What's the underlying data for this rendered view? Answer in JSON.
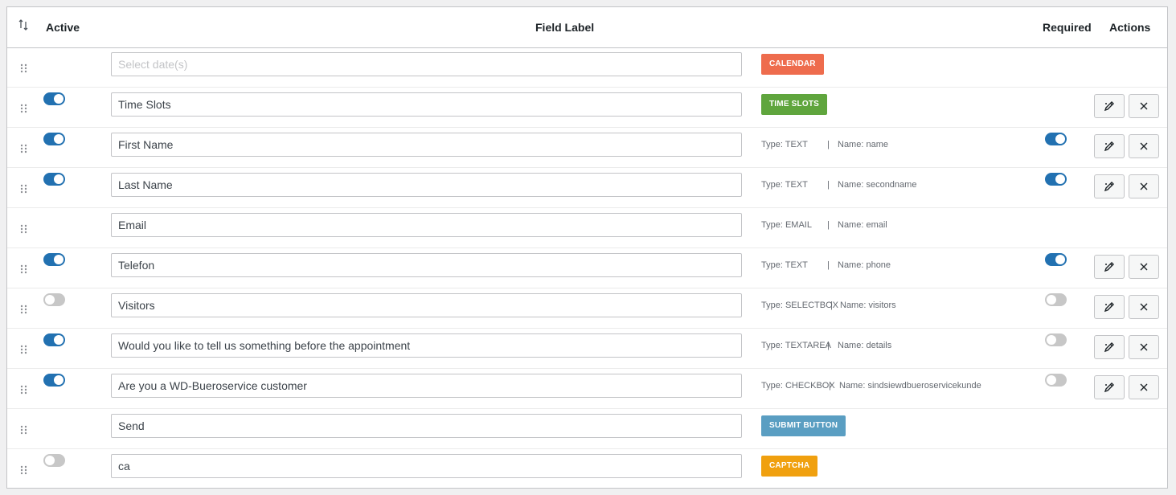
{
  "colors": {
    "toggle_on": "#2271b1",
    "toggle_off": "#c7c7c7",
    "calendar_badge": "#ee6c4d",
    "time_slots_badge": "#5fa53d",
    "submit_badge": "#5a9ec2",
    "captcha_badge": "#f0a00f"
  },
  "header": {
    "sort_icon": "sort-arrows-icon",
    "active": "Active",
    "field_label": "Field Label",
    "required": "Required",
    "actions": "Actions"
  },
  "rows": [
    {
      "label": "",
      "placeholder": "Select date(s)",
      "badge": "CALENDAR"
    },
    {
      "label": "Time Slots",
      "active": true,
      "badge": "TIME SLOTS",
      "actions": true
    },
    {
      "label": "First Name",
      "active": true,
      "type": "Type: TEXT",
      "sep": "|",
      "name": "Name: name",
      "required": true,
      "actions": true
    },
    {
      "label": "Last Name",
      "active": true,
      "type": "Type: TEXT",
      "sep": "|",
      "name": "Name: secondname",
      "required": true,
      "actions": true
    },
    {
      "label": "Email",
      "type": "Type: EMAIL",
      "sep": "|",
      "name": "Name: email"
    },
    {
      "label": "Telefon",
      "active": true,
      "type": "Type: TEXT",
      "sep": "|",
      "name": "Name: phone",
      "required": true,
      "actions": true
    },
    {
      "label": "Visitors",
      "active": false,
      "type": "Type: SELECTBOX",
      "sep": "|",
      "name": "Name: visitors",
      "required": false,
      "actions": true
    },
    {
      "label": "Would you like to tell us something before the appointment",
      "active": true,
      "type": "Type: TEXTAREA",
      "sep": "|",
      "name": "Name: details",
      "required": false,
      "actions": true
    },
    {
      "label": "Are you a WD-Bueroservice customer",
      "active": true,
      "type": "Type: CHECKBOX",
      "sep": "|",
      "name": "Name: sindsiewdbueroservicekunde",
      "required": false,
      "actions": true
    },
    {
      "label": "Send",
      "badge": "SUBMIT BUTTON"
    },
    {
      "label": "ca",
      "active": false,
      "badge": "CAPTCHA"
    }
  ]
}
